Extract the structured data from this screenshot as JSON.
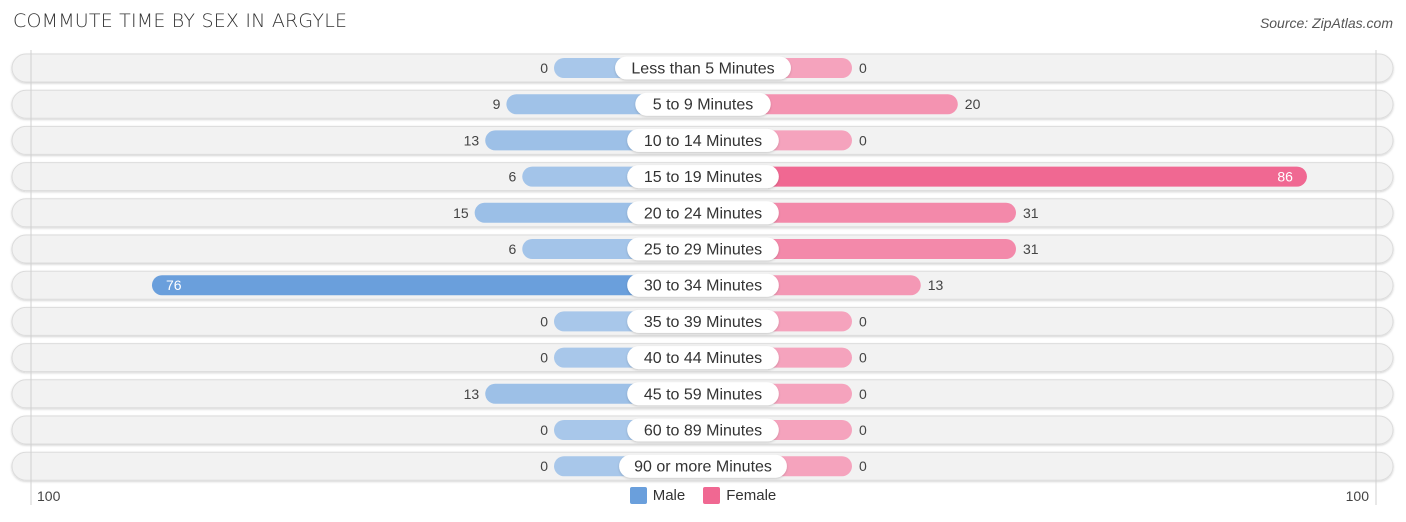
{
  "header": {
    "title": "COMMUTE TIME BY SEX IN ARGYLE",
    "source": "Source: ZipAtlas.com"
  },
  "colors": {
    "male": "#6a9fdc",
    "male_light": "#a8c7ea",
    "female": "#f06892",
    "female_light": "#f5a3bd",
    "row_bg": "#f2f2f2",
    "label_bg": "#ffffff"
  },
  "axis": {
    "left_label": "100",
    "right_label": "100"
  },
  "legend": [
    {
      "label": "Male",
      "color": "#6a9fdc"
    },
    {
      "label": "Female",
      "color": "#f06892"
    }
  ],
  "chart_data": {
    "type": "bar",
    "orientation": "horizontal-diverging",
    "title": "COMMUTE TIME BY SEX IN ARGYLE",
    "xlabel": "",
    "ylabel": "",
    "xlim": [
      -100,
      100
    ],
    "legend_position": "bottom-center",
    "categories": [
      "Less than 5 Minutes",
      "5 to 9 Minutes",
      "10 to 14 Minutes",
      "15 to 19 Minutes",
      "20 to 24 Minutes",
      "25 to 29 Minutes",
      "30 to 34 Minutes",
      "35 to 39 Minutes",
      "40 to 44 Minutes",
      "45 to 59 Minutes",
      "60 to 89 Minutes",
      "90 or more Minutes"
    ],
    "series": [
      {
        "name": "Male",
        "values": [
          0,
          9,
          13,
          6,
          15,
          6,
          76,
          0,
          0,
          13,
          0,
          0
        ]
      },
      {
        "name": "Female",
        "values": [
          0,
          20,
          0,
          86,
          31,
          31,
          13,
          0,
          0,
          0,
          0,
          0
        ]
      }
    ]
  }
}
